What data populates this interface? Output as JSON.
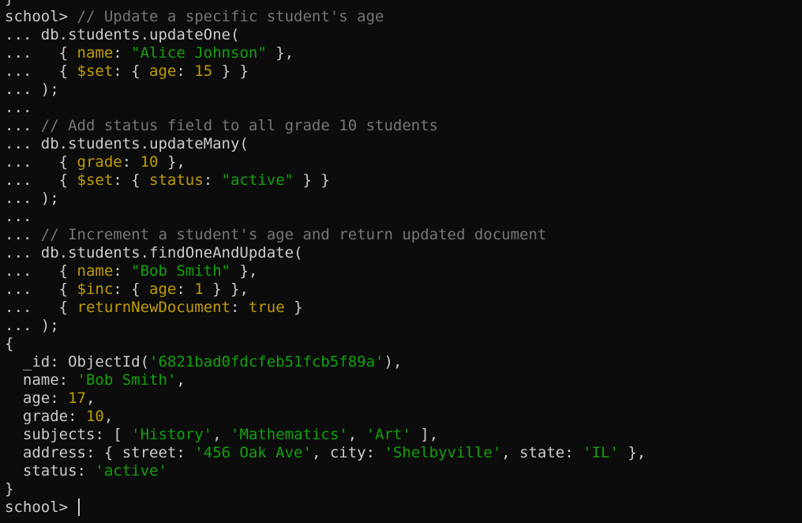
{
  "window": {
    "type": "terminal",
    "background": "#0c0c0c"
  },
  "colors": {
    "default": "#cccccc",
    "comment": "#767676",
    "string": "#13a10e",
    "keyword": "#c19c00",
    "number": "#c19c00"
  },
  "lines": [
    [
      {
        "t": "}",
        "c": "default"
      }
    ],
    [
      {
        "t": "school> ",
        "c": "default"
      },
      {
        "t": "// Update a specific student's age",
        "c": "comment"
      }
    ],
    [
      {
        "t": "... db.students.updateOne(",
        "c": "default"
      }
    ],
    [
      {
        "t": "...   { ",
        "c": "default"
      },
      {
        "t": "name",
        "c": "keyword"
      },
      {
        "t": ": ",
        "c": "default"
      },
      {
        "t": "\"Alice Johnson\"",
        "c": "string"
      },
      {
        "t": " },",
        "c": "default"
      }
    ],
    [
      {
        "t": "...   { ",
        "c": "default"
      },
      {
        "t": "$set",
        "c": "keyword"
      },
      {
        "t": ": { ",
        "c": "default"
      },
      {
        "t": "age",
        "c": "keyword"
      },
      {
        "t": ": ",
        "c": "default"
      },
      {
        "t": "15",
        "c": "number"
      },
      {
        "t": " } }",
        "c": "default"
      }
    ],
    [
      {
        "t": "... );",
        "c": "default"
      }
    ],
    [
      {
        "t": "...",
        "c": "default"
      }
    ],
    [
      {
        "t": "... ",
        "c": "default"
      },
      {
        "t": "// Add status field to all grade 10 students",
        "c": "comment"
      }
    ],
    [
      {
        "t": "... db.students.updateMany(",
        "c": "default"
      }
    ],
    [
      {
        "t": "...   { ",
        "c": "default"
      },
      {
        "t": "grade",
        "c": "keyword"
      },
      {
        "t": ": ",
        "c": "default"
      },
      {
        "t": "10",
        "c": "number"
      },
      {
        "t": " },",
        "c": "default"
      }
    ],
    [
      {
        "t": "...   { ",
        "c": "default"
      },
      {
        "t": "$set",
        "c": "keyword"
      },
      {
        "t": ": { ",
        "c": "default"
      },
      {
        "t": "status",
        "c": "keyword"
      },
      {
        "t": ": ",
        "c": "default"
      },
      {
        "t": "\"active\"",
        "c": "string"
      },
      {
        "t": " } }",
        "c": "default"
      }
    ],
    [
      {
        "t": "... );",
        "c": "default"
      }
    ],
    [
      {
        "t": "...",
        "c": "default"
      }
    ],
    [
      {
        "t": "... ",
        "c": "default"
      },
      {
        "t": "// Increment a student's age and return updated document",
        "c": "comment"
      }
    ],
    [
      {
        "t": "... db.students.findOneAndUpdate(",
        "c": "default"
      }
    ],
    [
      {
        "t": "...   { ",
        "c": "default"
      },
      {
        "t": "name",
        "c": "keyword"
      },
      {
        "t": ": ",
        "c": "default"
      },
      {
        "t": "\"Bob Smith\"",
        "c": "string"
      },
      {
        "t": " },",
        "c": "default"
      }
    ],
    [
      {
        "t": "...   { ",
        "c": "default"
      },
      {
        "t": "$inc",
        "c": "keyword"
      },
      {
        "t": ": { ",
        "c": "default"
      },
      {
        "t": "age",
        "c": "keyword"
      },
      {
        "t": ": ",
        "c": "default"
      },
      {
        "t": "1",
        "c": "number"
      },
      {
        "t": " } },",
        "c": "default"
      }
    ],
    [
      {
        "t": "...   { ",
        "c": "default"
      },
      {
        "t": "returnNewDocument",
        "c": "keyword"
      },
      {
        "t": ": ",
        "c": "default"
      },
      {
        "t": "true",
        "c": "keyword"
      },
      {
        "t": " }",
        "c": "default"
      }
    ],
    [
      {
        "t": "... );",
        "c": "default"
      }
    ],
    [
      {
        "t": "{",
        "c": "default"
      }
    ],
    [
      {
        "t": "  _id: ObjectId(",
        "c": "default"
      },
      {
        "t": "'6821bad0fdcfeb51fcb5f89a'",
        "c": "string"
      },
      {
        "t": "),",
        "c": "default"
      }
    ],
    [
      {
        "t": "  name: ",
        "c": "default"
      },
      {
        "t": "'Bob Smith'",
        "c": "string"
      },
      {
        "t": ",",
        "c": "default"
      }
    ],
    [
      {
        "t": "  age: ",
        "c": "default"
      },
      {
        "t": "17",
        "c": "number"
      },
      {
        "t": ",",
        "c": "default"
      }
    ],
    [
      {
        "t": "  grade: ",
        "c": "default"
      },
      {
        "t": "10",
        "c": "number"
      },
      {
        "t": ",",
        "c": "default"
      }
    ],
    [
      {
        "t": "  subjects: [ ",
        "c": "default"
      },
      {
        "t": "'History'",
        "c": "string"
      },
      {
        "t": ", ",
        "c": "default"
      },
      {
        "t": "'Mathematics'",
        "c": "string"
      },
      {
        "t": ", ",
        "c": "default"
      },
      {
        "t": "'Art'",
        "c": "string"
      },
      {
        "t": " ],",
        "c": "default"
      }
    ],
    [
      {
        "t": "  address: { street: ",
        "c": "default"
      },
      {
        "t": "'456 Oak Ave'",
        "c": "string"
      },
      {
        "t": ", city: ",
        "c": "default"
      },
      {
        "t": "'Shelbyville'",
        "c": "string"
      },
      {
        "t": ", state: ",
        "c": "default"
      },
      {
        "t": "'IL'",
        "c": "string"
      },
      {
        "t": " },",
        "c": "default"
      }
    ],
    [
      {
        "t": "  status: ",
        "c": "default"
      },
      {
        "t": "'active'",
        "c": "string"
      }
    ],
    [
      {
        "t": "}",
        "c": "default"
      }
    ]
  ],
  "prompt": {
    "text": "school> "
  }
}
